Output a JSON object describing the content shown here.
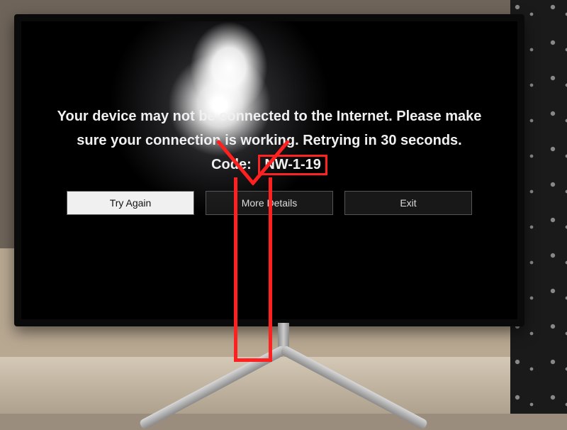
{
  "error": {
    "line1": "Your device may not be connected to the Internet. Please make",
    "line2": "sure your connection is working. Retrying in 30 seconds.",
    "code_label": "Code:",
    "code_value": "NW-1-19"
  },
  "buttons": {
    "try_again": "Try Again",
    "more_details": "More Details",
    "exit": "Exit"
  },
  "annotation": {
    "highlight_color": "#ff2020"
  }
}
